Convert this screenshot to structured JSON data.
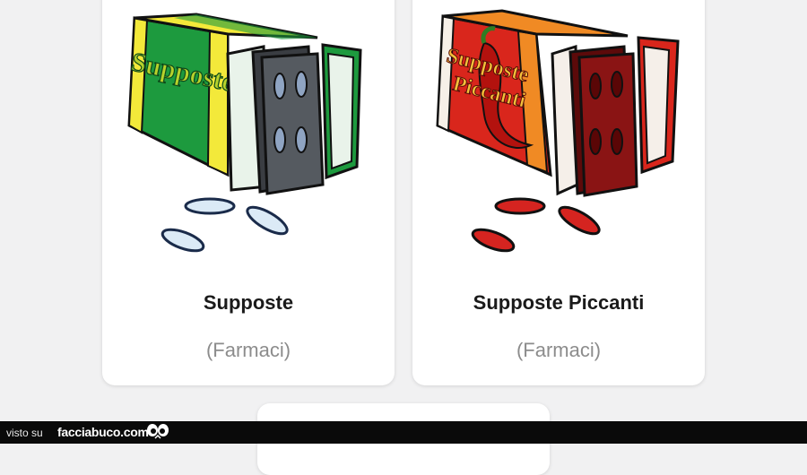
{
  "cards": [
    {
      "title": "Supposte",
      "category": "(Farmaci)",
      "box_label": "Supposte",
      "theme": "green"
    },
    {
      "title": "Supposte Piccanti",
      "category": "(Farmaci)",
      "box_label_line1": "Supposte",
      "box_label_line2": "Piccanti",
      "theme": "red"
    }
  ],
  "colors": {
    "green_box": "#1d9a3e",
    "yellow_stripe": "#f3e93a",
    "red_box": "#d9261c",
    "orange_stripe": "#f08a24",
    "blister_grey": "#555a60",
    "blister_red": "#8a1414",
    "pill_blue": "#dbeaf6",
    "pill_red": "#d52420"
  },
  "footer": {
    "prefix": "visto su",
    "site": "facciabuco.com"
  }
}
